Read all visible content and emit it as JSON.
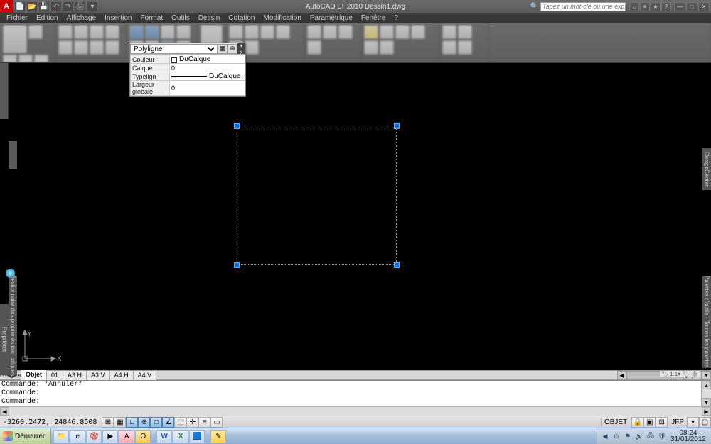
{
  "app": {
    "title": "AutoCAD LT 2010    Dessin1.dwg",
    "search_placeholder": "Tapez un mot-clé ou une expressio"
  },
  "menu": [
    "Fichier",
    "Edition",
    "Affichage",
    "Insertion",
    "Format",
    "Outils",
    "Dessin",
    "Cotation",
    "Modification",
    "Paramétrique",
    "Fenêtre",
    "?"
  ],
  "properties": {
    "type_label": "Polyligne",
    "rows": [
      {
        "label": "Couleur",
        "value": "DuCalque",
        "swatch": true
      },
      {
        "label": "Calque",
        "value": "0"
      },
      {
        "label": "Typelign",
        "value": "DuCalque",
        "linetype": true
      },
      {
        "label": "Largeur globale",
        "value": "0"
      }
    ]
  },
  "model_tabs": {
    "nav": [
      "⏮",
      "◀",
      "▶",
      "⏭"
    ],
    "tabs": [
      "Objet",
      "01",
      "A3 H",
      "A3 V",
      "A4 H",
      "A4 V"
    ],
    "active": 0
  },
  "command": {
    "lines": [
      "Commande: *Annuler*",
      "Commande:",
      "Commande:"
    ],
    "prompt": ""
  },
  "status": {
    "coords": "-3260.2472, 24846.8508",
    "right_label": "OBJET",
    "user": "JFP"
  },
  "palettes": {
    "left1": "Propriétés",
    "left2": "Gestionnaire des propriétés des calques",
    "right1": "Palettes d'outils - Toutes les palettes",
    "right2": "DesignCenter"
  },
  "taskbar": {
    "start": "Démarrer",
    "time": "08:24",
    "date": "31/01/2012"
  },
  "icons": {
    "search": "🔍",
    "gear": "⚙",
    "min": "—",
    "max": "□",
    "close": "✕",
    "help": "?",
    "down": "▾",
    "up": "▴",
    "left": "◀",
    "right": "▶",
    "lock": "🔒"
  }
}
